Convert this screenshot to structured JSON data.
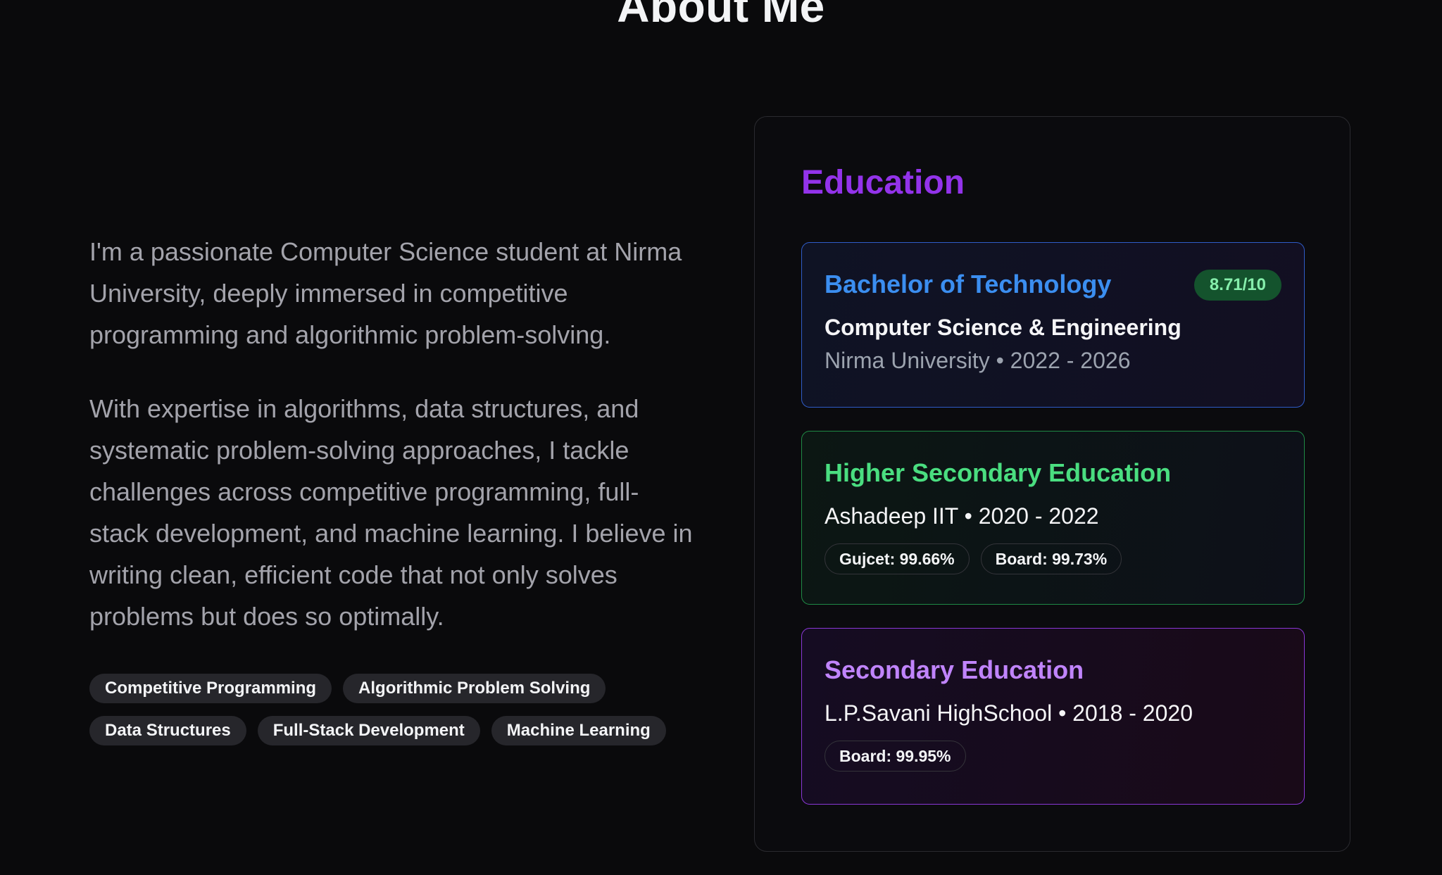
{
  "section": {
    "title": "About Me"
  },
  "about": {
    "paragraphs": [
      "I'm a passionate Computer Science student at Nirma University, deeply immersed in competitive programming and algorithmic problem-solving.",
      "With expertise in algorithms, data structures, and systematic problem-solving approaches, I tackle challenges across competitive programming, full-stack development, and machine learning. I believe in writing clean, efficient code that not only solves problems but does so optimally."
    ],
    "tags": [
      "Competitive Programming",
      "Algorithmic Problem Solving",
      "Data Structures",
      "Full-Stack Development",
      "Machine Learning"
    ]
  },
  "education": {
    "heading": "Education",
    "btech": {
      "title": "Bachelor of Technology",
      "gpa": "8.71/10",
      "field": "Computer Science & Engineering",
      "meta": "Nirma University • 2022 - 2026"
    },
    "hse": {
      "title": "Higher Secondary Education",
      "meta": "Ashadeep IIT • 2020 - 2022",
      "scores": [
        "Gujcet: 99.66%",
        "Board: 99.73%"
      ]
    },
    "se": {
      "title": "Secondary Education",
      "meta": "L.P.Savani HighSchool • 2018 - 2020",
      "scores": [
        "Board: 99.95%"
      ]
    }
  },
  "colors": {
    "background": "#0a0a0c",
    "heading_purple": "#9333ea",
    "btech_blue": "#3b8ef0",
    "hse_green": "#4ade80",
    "se_violet": "#c084fc"
  }
}
